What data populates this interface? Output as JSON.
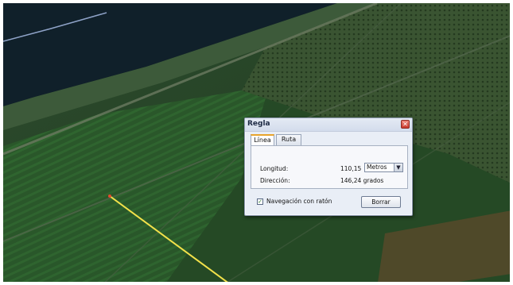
{
  "dialog": {
    "title": "Regla",
    "close_icon": "close-icon",
    "tabs": [
      {
        "label": "Línea",
        "active": true
      },
      {
        "label": "Ruta",
        "active": false
      }
    ],
    "length": {
      "label": "Longitud:",
      "value": "110,15",
      "unit": "Metros"
    },
    "direction": {
      "label": "Dirección:",
      "value": "146,24 grados"
    },
    "mouse_navigation": {
      "label": "Navegación con ratón",
      "checked": true
    },
    "clear_button": "Borrar"
  },
  "colors": {
    "measure_line": "#f2e14a",
    "start_point": "#e64a2e",
    "river": "#10202a",
    "tab_accent": "#e8a42c"
  }
}
